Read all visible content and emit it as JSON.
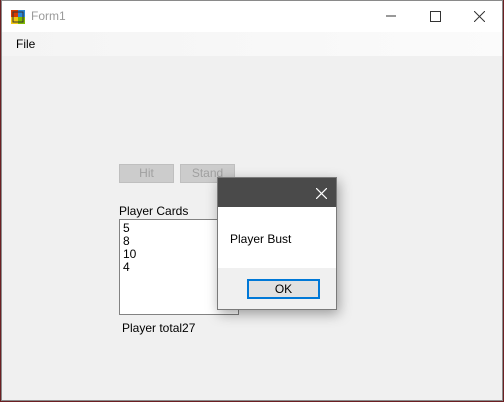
{
  "window": {
    "title": "Form1"
  },
  "menu": {
    "file_label": "File"
  },
  "buttons": {
    "hit_label": "Hit",
    "stand_label": "Stand"
  },
  "player": {
    "cards_label": "Player Cards",
    "cards": [
      "5",
      "8",
      "10",
      "4"
    ],
    "total_label": "Player total27"
  },
  "dialog": {
    "message": "Player Bust",
    "ok_label": "OK"
  },
  "icons": {
    "minimize": "minimize-icon",
    "maximize": "maximize-icon",
    "close": "close-icon"
  }
}
